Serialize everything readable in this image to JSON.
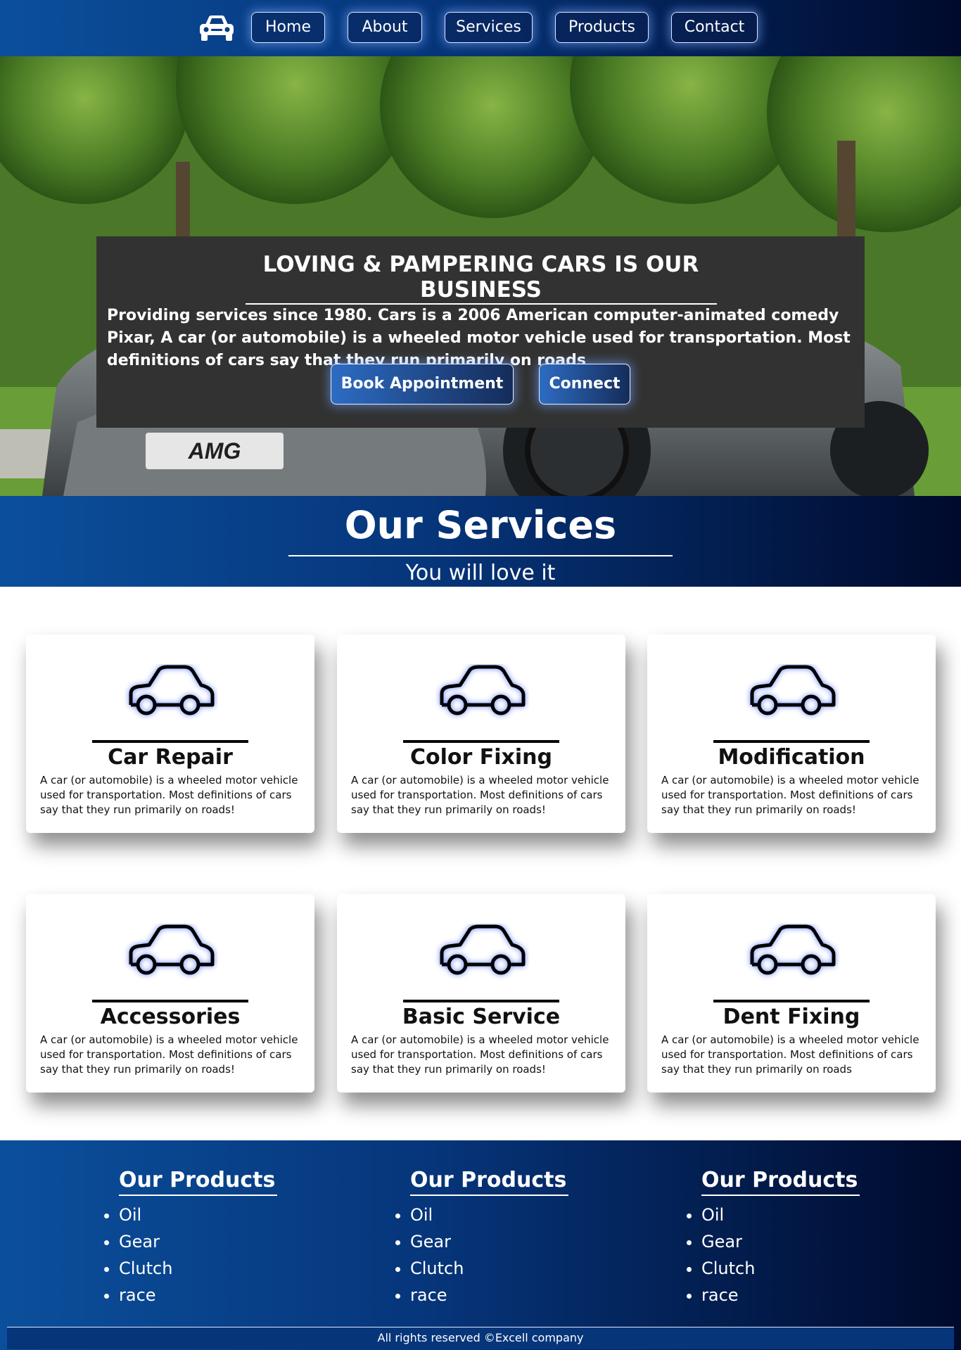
{
  "nav": {
    "logo_icon": "car-front-icon",
    "items": [
      {
        "label": "Home"
      },
      {
        "label": "About"
      },
      {
        "label": "Services"
      },
      {
        "label": "Products"
      },
      {
        "label": "Contact"
      }
    ]
  },
  "hero": {
    "title": "LOVING & PAMPERING CARS IS OUR BUSINESS",
    "text": "Providing services since 1980. Cars is a 2006 American computer-animated comedy Pixar, A car (or automobile) is a wheeled motor vehicle used for transportation. Most definitions of cars say that they run primarily on roads",
    "buttons": {
      "book": "Book Appointment",
      "connect": "Connect"
    },
    "plate_text": "AMG"
  },
  "services": {
    "title": "Our Services",
    "subtitle": "You will love it",
    "icon": "car-outline-icon",
    "cards": [
      {
        "title": "Car Repair",
        "text": "A car (or automobile) is a wheeled motor vehicle used for transportation. Most definitions of cars say that they run primarily on roads!"
      },
      {
        "title": "Color Fixing",
        "text": "A car (or automobile) is a wheeled motor vehicle used for transportation. Most definitions of cars say that they run primarily on roads!"
      },
      {
        "title": "Modification",
        "text": "A car (or automobile) is a wheeled motor vehicle used for transportation. Most definitions of cars say that they run primarily on roads!"
      },
      {
        "title": "Accessories",
        "text": "A car (or automobile) is a wheeled motor vehicle used for transportation. Most definitions of cars say that they run primarily on roads!"
      },
      {
        "title": "Basic Service",
        "text": "A car (or automobile) is a wheeled motor vehicle used for transportation. Most definitions of cars say that they run primarily on roads!"
      },
      {
        "title": "Dent Fixing",
        "text": "A car (or automobile) is a wheeled motor vehicle used for transportation. Most definitions of cars say that they run primarily on roads"
      }
    ]
  },
  "footer": {
    "columns": [
      {
        "title": "Our Products",
        "items": [
          "Oil",
          "Gear",
          "Clutch",
          "race"
        ]
      },
      {
        "title": "Our Products",
        "items": [
          "Oil",
          "Gear",
          "Clutch",
          "race"
        ]
      },
      {
        "title": "Our Products",
        "items": [
          "Oil",
          "Gear",
          "Clutch",
          "race"
        ]
      }
    ],
    "copyright": "All rights reserved ©Excell company"
  },
  "colors": {
    "brand_blue": "#0b4f9c",
    "brand_dark": "#000a2c",
    "hero_box": "#323232"
  }
}
